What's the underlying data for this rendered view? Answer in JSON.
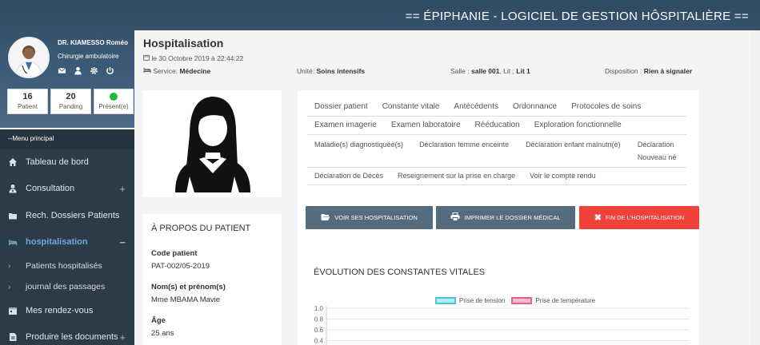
{
  "app": {
    "title": "== ÉPIPHANIE - LOGICIEL DE GESTION HÔSPITALIÈRE =="
  },
  "doctor": {
    "name": "DR. KIAMESSO Roméo",
    "specialty": "Chirurgie ambulatoire"
  },
  "stats": [
    {
      "value": "16",
      "label": "Patient"
    },
    {
      "value": "20",
      "label": "Panding"
    },
    {
      "label": "Présent(e)",
      "status_color": "#1bb934"
    }
  ],
  "menu": {
    "header": "--Menu principal",
    "items": [
      {
        "label": "Tableau de bord",
        "icon": "home-icon",
        "plus": ""
      },
      {
        "label": "Consultation",
        "icon": "user-md-icon",
        "plus": "+"
      },
      {
        "label": "Rech. Dossiers Patients",
        "icon": "folder-icon",
        "plus": ""
      },
      {
        "label": "hospitalisation",
        "icon": "bed-icon",
        "plus": "−"
      }
    ],
    "sub_items": [
      {
        "label": "Patients hospitalisés"
      },
      {
        "label": "journal des passages"
      }
    ],
    "items_after": [
      {
        "label": "Mes rendez-vous",
        "icon": "calendar-icon",
        "plus": ""
      },
      {
        "label": "Produire les documents",
        "icon": "document-icon",
        "plus": "+"
      }
    ]
  },
  "page": {
    "title": "Hospitalisation",
    "date": "le 30 Octobre 2019 à 22:44:22",
    "service_label": "Service:",
    "service_value": "Médecine",
    "unit_label": "Unité:",
    "unit_value": "Soins intensifs",
    "room_label": "Salle :",
    "room_value": "salle 001",
    "bed_sep": ", Lit :",
    "bed_value": "Lit 1",
    "disposition_label": "Disposition :",
    "disposition_value": "Rien à signaler"
  },
  "patient": {
    "about_title": "À PROPOS DU PATIENT",
    "code_label": "Code patient",
    "code_value": "PAT-002/05-2019",
    "name_label": "Nom(s) et prénom(s)",
    "name_value": "Mme MBAMA Mavie",
    "age_label": "Âge",
    "age_value": "25 ans"
  },
  "tabs": {
    "row1": [
      "Dossier patient",
      "Constante vitale",
      "Antécédents",
      "Ordonnance",
      "Protocoles de soins"
    ],
    "row2": [
      "Examen imagerie",
      "Examen laboratoire",
      "Rééducation",
      "Exploration fonctionnelle"
    ],
    "row3": [
      "Maladie(s) diagnostiquée(s)",
      "Déclaration femme enceinte",
      "Déclaration enfant malnutri(e)",
      "Déclaration Nouveau né"
    ],
    "row4": [
      "Déclaration de Décès",
      "Reseignement sur la prise en charge",
      "Voir le compte rendu"
    ]
  },
  "buttons": {
    "view_hosp": "VOIR SES HOSPITALISATION",
    "print_file": "IMPRIMER LE DOSSIER MÉDICAL",
    "end_hosp": "FIN DE L'HOSPITALISATION"
  },
  "chart_data": {
    "type": "line",
    "title": "ÉVOLUTION DES CONSTANTES VITALES",
    "series": [
      {
        "name": "Prise de tension",
        "color": "#4fc3d9",
        "fill": "#b2ebf2",
        "values": []
      },
      {
        "name": "Prise de température",
        "color": "#e8608a",
        "fill": "#f8bbd0",
        "values": []
      }
    ],
    "y_ticks": [
      "1.0",
      "0.8",
      "0.6",
      "0.4"
    ],
    "ylim": [
      0,
      1.0
    ],
    "legend_position": "top-center",
    "grid": true
  }
}
